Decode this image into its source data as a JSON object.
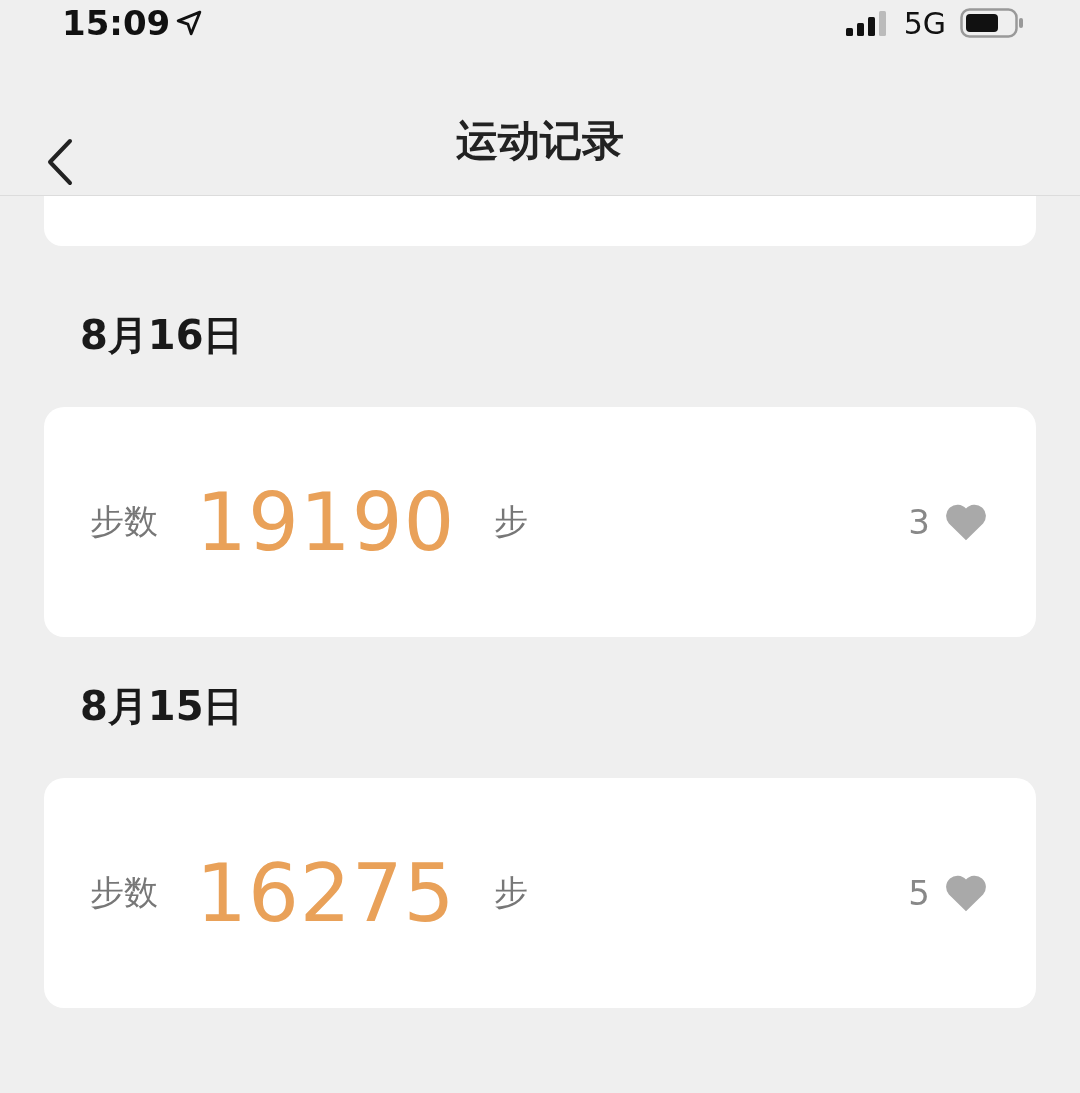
{
  "status_bar": {
    "time": "15:09",
    "network": "5G"
  },
  "nav_bar": {
    "title": "运动记录"
  },
  "days": [
    {
      "date": "8月16日",
      "label": "步数",
      "steps": "19190",
      "unit": "步",
      "likes": "3"
    },
    {
      "date": "8月15日",
      "label": "步数",
      "steps": "16275",
      "unit": "步",
      "likes": "5"
    }
  ]
}
